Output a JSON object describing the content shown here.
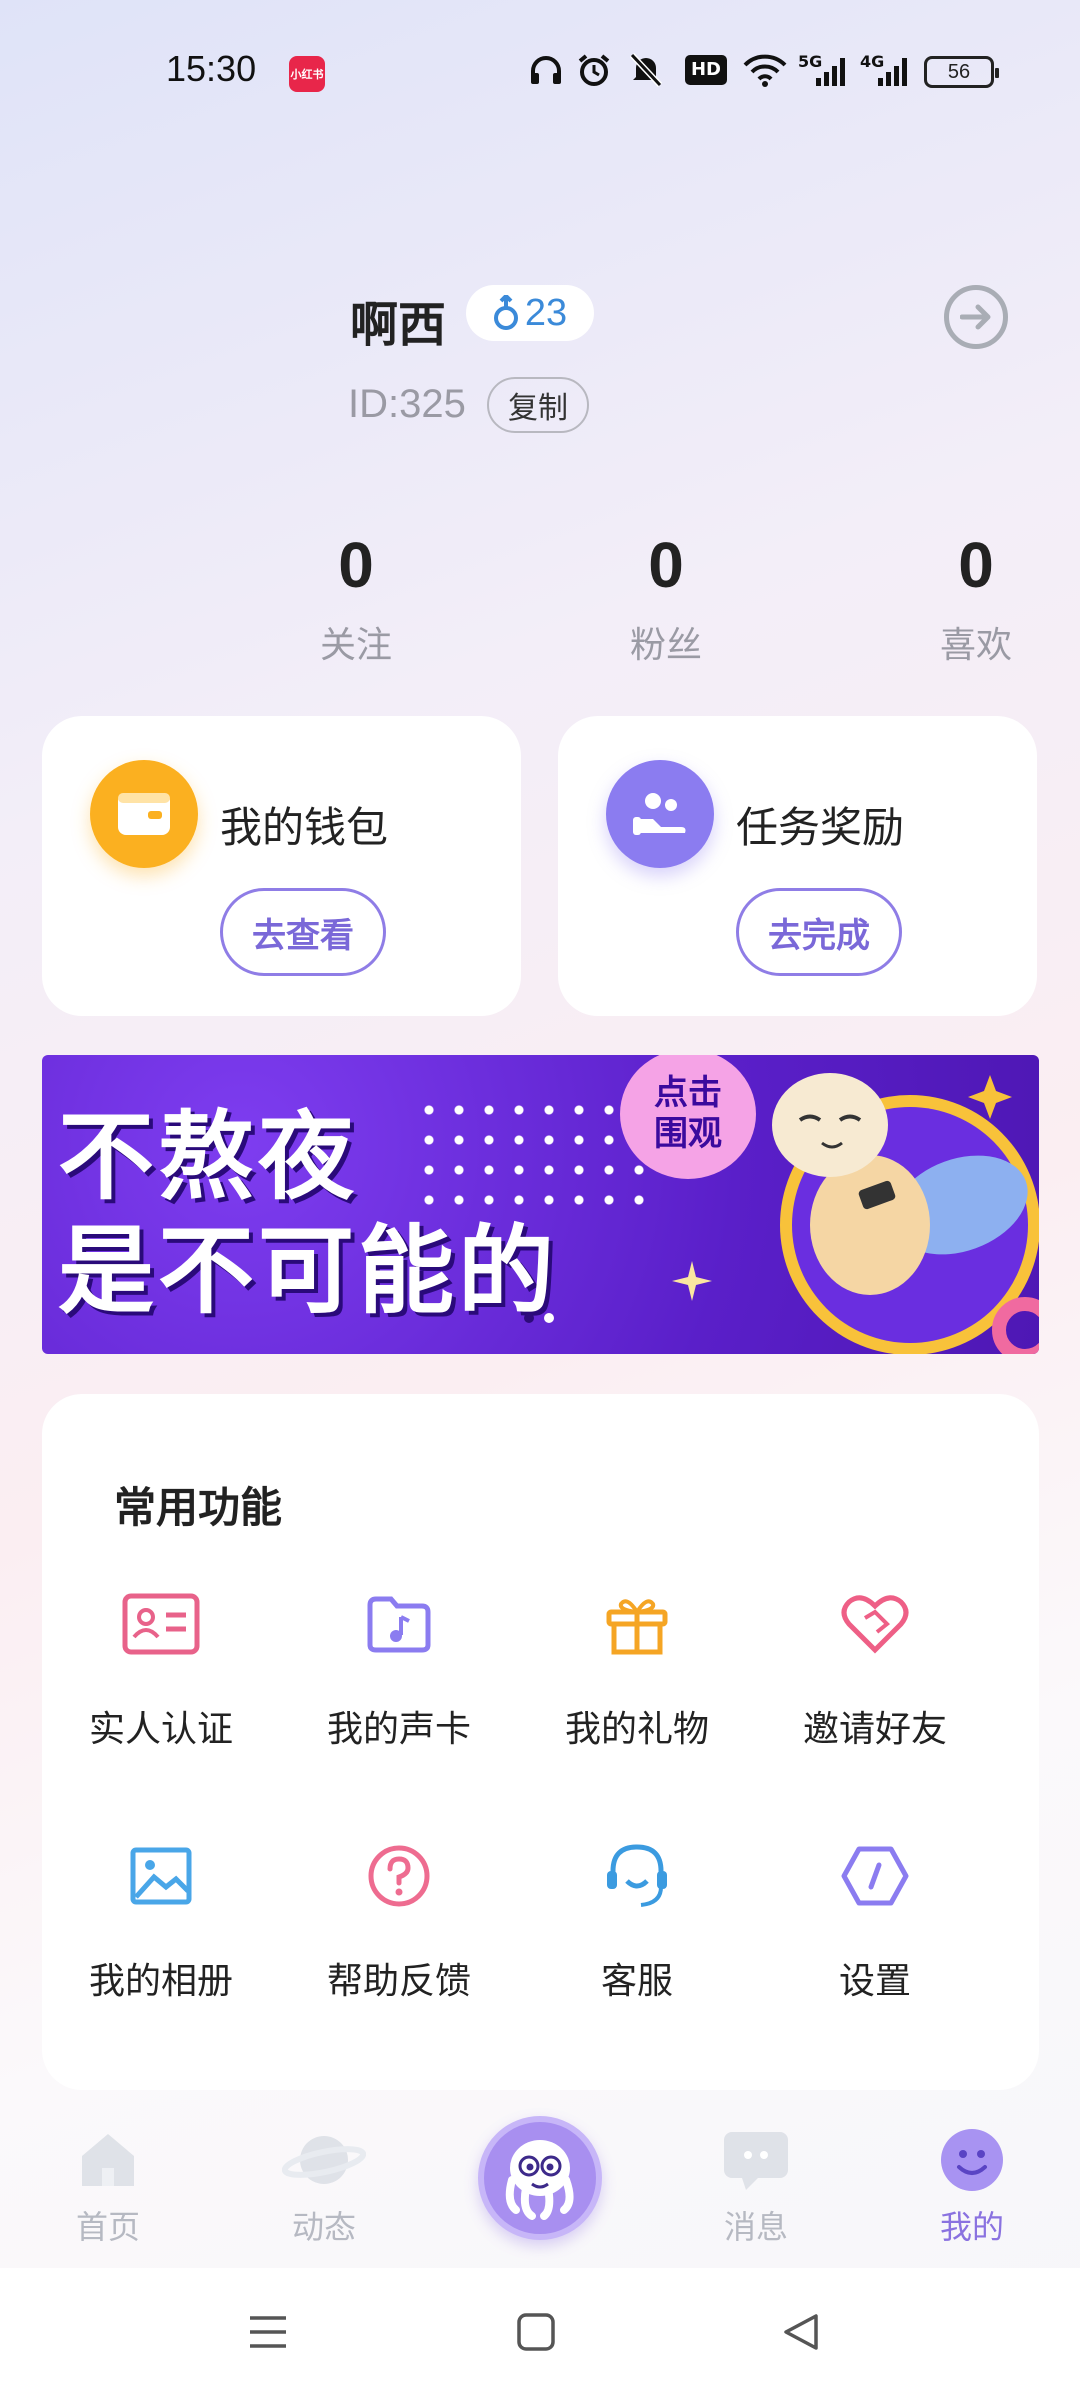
{
  "status_bar": {
    "time": "15:30",
    "app_badge": "小红书",
    "icons": [
      "headphones-icon",
      "alarm-icon",
      "mute-icon",
      "hd-icon",
      "wifi-icon",
      "signal-5g-icon",
      "signal-4g-icon"
    ],
    "hd_label": "HD",
    "net1": "5G",
    "net2": "4G",
    "battery": "56"
  },
  "profile": {
    "username": "啊西",
    "level": "23",
    "id_label": "ID:325",
    "copy_label": "复制"
  },
  "stats": [
    {
      "value": "0",
      "label": "关注"
    },
    {
      "value": "0",
      "label": "粉丝"
    },
    {
      "value": "0",
      "label": "喜欢"
    }
  ],
  "cards": {
    "wallet": {
      "title": "我的钱包",
      "button": "去查看",
      "color": "#fbb020"
    },
    "tasks": {
      "title": "任务奖励",
      "button": "去完成",
      "color": "#8b7cf0"
    }
  },
  "banner": {
    "line1": "不熬夜",
    "line2": "是不可能的",
    "badge_line1": "点击",
    "badge_line2": "围观",
    "pages": 2,
    "active_page": 2
  },
  "functions": {
    "title": "常用功能",
    "items": [
      {
        "label": "实人认证",
        "icon": "id-card-icon",
        "color": "#e8628a"
      },
      {
        "label": "我的声卡",
        "icon": "music-folder-icon",
        "color": "#8b7cf0"
      },
      {
        "label": "我的礼物",
        "icon": "gift-icon",
        "color": "#f5a524"
      },
      {
        "label": "邀请好友",
        "icon": "heart-handshake-icon",
        "color": "#ee5f86"
      },
      {
        "label": "我的相册",
        "icon": "image-icon",
        "color": "#49a6e8"
      },
      {
        "label": "帮助反馈",
        "icon": "help-icon",
        "color": "#ee6c90"
      },
      {
        "label": "客服",
        "icon": "headset-icon",
        "color": "#3b9be0"
      },
      {
        "label": "设置",
        "icon": "settings-hexagon-icon",
        "color": "#8b7cf0"
      }
    ]
  },
  "bottom_nav": [
    {
      "label": "首页",
      "icon": "home-icon"
    },
    {
      "label": "动态",
      "icon": "planet-icon"
    },
    {
      "label": "",
      "icon": "octopus-icon"
    },
    {
      "label": "消息",
      "icon": "message-icon"
    },
    {
      "label": "我的",
      "icon": "smile-icon",
      "active": true
    }
  ],
  "accent": "#8a72e0"
}
